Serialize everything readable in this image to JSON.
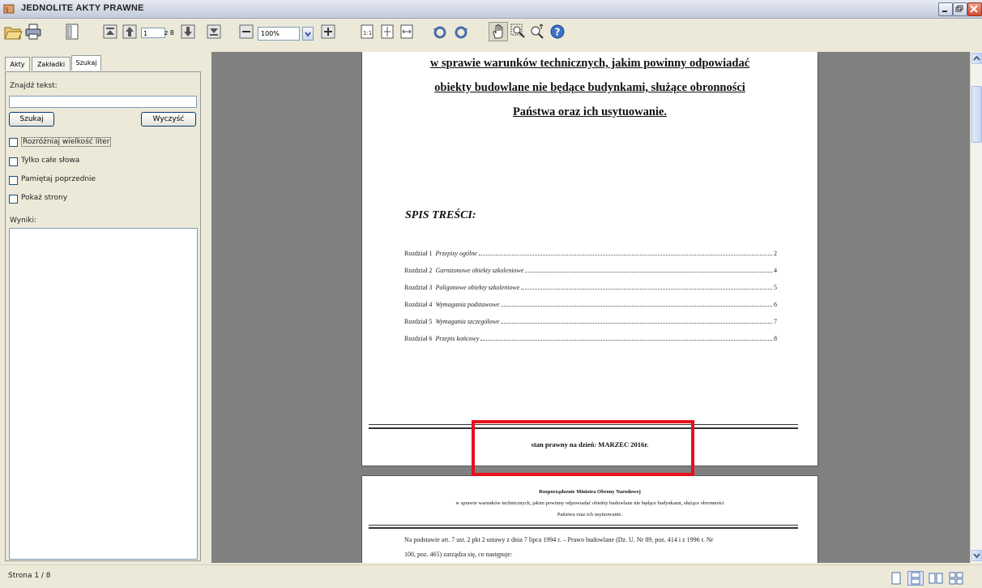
{
  "window": {
    "title": "JEDNOLITE AKTY PRAWNE"
  },
  "toolbar": {
    "page_current": "1",
    "page_total": "z 8",
    "zoom": "100%"
  },
  "sidebar": {
    "tabs": [
      {
        "label": "Akty"
      },
      {
        "label": "Zakładki"
      },
      {
        "label": "Szukaj"
      }
    ],
    "find_label": "Znajdź tekst:",
    "find_value": "",
    "search_button": "Szukaj",
    "clear_button": "Wyczyść",
    "options": [
      {
        "label": "Rozróżniaj wielkość liter",
        "checked": false
      },
      {
        "label": "Tylko całe słowa",
        "checked": false
      },
      {
        "label": "Pamiętaj poprzednie",
        "checked": false
      },
      {
        "label": "Pokaż strony",
        "checked": false
      }
    ],
    "results_label": "Wyniki:"
  },
  "document": {
    "heading_lines": [
      "w sprawie warunków technicznych, jakim powinny odpowiadać",
      "obiekty budowlane nie będące budynkami, służące obronności",
      "Państwa oraz ich usytuowanie."
    ],
    "toc_title": "SPIS TREŚCI:",
    "toc": [
      {
        "chapter": "Rozdział 1",
        "name": "Przepisy ogólne",
        "page": "2"
      },
      {
        "chapter": "Rozdział 2",
        "name": "Garnizonowe obiekty szkoleniowe",
        "page": "4"
      },
      {
        "chapter": "Rozdział 3",
        "name": "Poligonowe obiekty szkoleniowe",
        "page": "5"
      },
      {
        "chapter": "Rozdział 4",
        "name": "Wymagania podstawowe",
        "page": "6"
      },
      {
        "chapter": "Rozdział 5",
        "name": "Wymagania szczegółowe",
        "page": "7"
      },
      {
        "chapter": "Rozdział 6",
        "name": "Przepis końcowy",
        "page": "8"
      }
    ],
    "legal_state": "stan prawny na dzień: MARZEC 2016r.",
    "page2": {
      "title": "Rozporządzenie Ministra Obrony Narodowej",
      "subtitle_line1": "w sprawie warunków technicznych, jakim powinny odpowiadać obiekty budowlane nie będące budynkami, służące obronności",
      "subtitle_line2": "Państwa oraz ich usytuowanie.",
      "body_line1": "Na podstawie art. 7 ust. 2 pkt 2 ustawy z dnia 7 lipca 1994 r. – Prawo budowlane (Dz. U. Nr 89, poz. 414 i z 1996 r. Nr",
      "body_line2": "100, poz. 465) zarządza się, co następuje:"
    }
  },
  "status": {
    "page_info": "Strona 1 / 8"
  },
  "colors": {
    "highlight": "#e8101c",
    "viewer_bg": "#808080",
    "chrome": "#ece9d8"
  }
}
